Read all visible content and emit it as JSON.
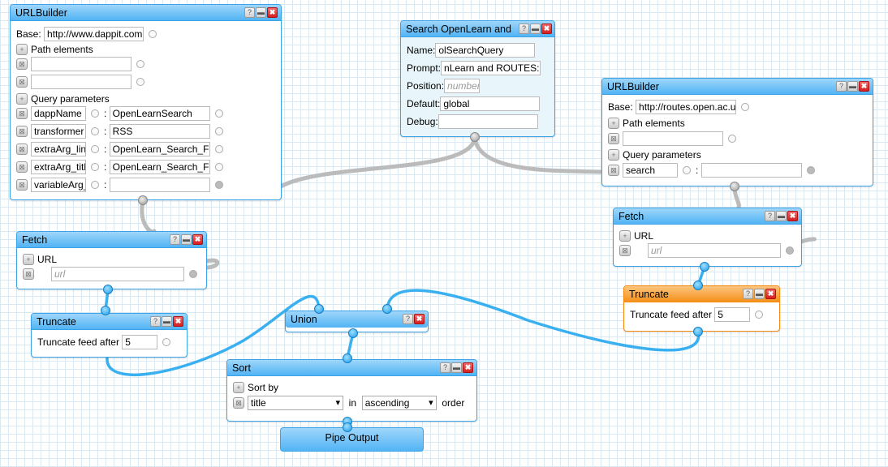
{
  "urlbuilder1": {
    "title": "URLBuilder",
    "base_label": "Base:",
    "base": "http://www.dappit.com.",
    "path_label": "Path elements",
    "query_label": "Query parameters",
    "params": [
      {
        "k": "dappName",
        "v": "OpenLearnSearch"
      },
      {
        "k": "transformer",
        "v": "RSS"
      },
      {
        "k": "extraArg_lin",
        "v": "OpenLearn_Search_F"
      },
      {
        "k": "extraArg_titl",
        "v": "OpenLearn_Search_F"
      },
      {
        "k": "variableArg_",
        "v": ""
      }
    ]
  },
  "search": {
    "title": "Search OpenLearn and",
    "name_label": "Name:",
    "name": "olSearchQuery",
    "prompt_label": "Prompt:",
    "prompt": "nLearn and ROUTES:",
    "position_label": "Position:",
    "position_placeholder": "number",
    "default_label": "Default:",
    "default": "global",
    "debug_label": "Debug:"
  },
  "urlbuilder2": {
    "title": "URLBuilder",
    "base_label": "Base:",
    "base": "http://routes.open.ac.u",
    "path_label": "Path elements",
    "query_label": "Query parameters",
    "param_key": "search"
  },
  "fetch1": {
    "title": "Fetch",
    "url_label": "URL",
    "url_placeholder": "url"
  },
  "fetch2": {
    "title": "Fetch",
    "url_label": "URL",
    "url_placeholder": "url"
  },
  "truncate1": {
    "title": "Truncate",
    "label": "Truncate feed after",
    "value": "5"
  },
  "truncate2": {
    "title": "Truncate",
    "label": "Truncate feed after",
    "value": "5"
  },
  "union": {
    "title": "Union"
  },
  "sort": {
    "title": "Sort",
    "sort_by_label": "Sort by",
    "field": "title",
    "in_label": "in",
    "direction": "ascending",
    "order_label": "order"
  },
  "output": {
    "title": "Pipe Output"
  },
  "buttons": {
    "help": "?",
    "min": "▬",
    "close": "✖",
    "add": "+",
    "remove": "⊠"
  },
  "colors": {
    "module_border": "#3aa3e8",
    "selected_border": "#f48a10",
    "wire": "#3ab0f0"
  }
}
